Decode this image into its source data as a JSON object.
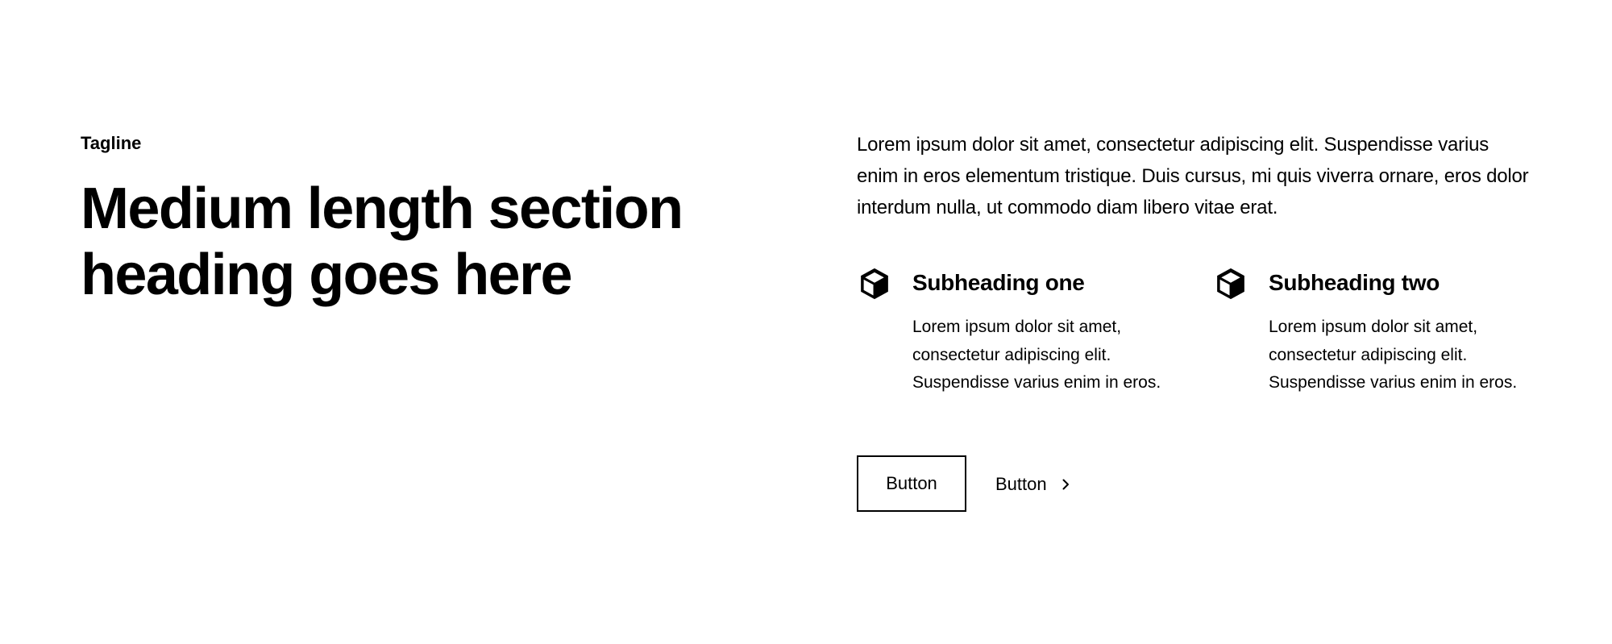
{
  "left": {
    "tagline": "Tagline",
    "heading_line1": "Medium length section",
    "heading_line2": "heading goes here"
  },
  "right": {
    "intro": "Lorem ipsum dolor sit amet, consectetur adipiscing elit. Suspendisse varius enim in eros elementum tristique. Duis cursus, mi quis viverra ornare, eros dolor interdum nulla, ut commodo diam libero vitae erat.",
    "features": [
      {
        "icon": "cube-icon",
        "title": "Subheading one",
        "description": "Lorem ipsum dolor sit amet, consectetur adipiscing elit. Suspendisse varius enim in eros."
      },
      {
        "icon": "cube-icon",
        "title": "Subheading two",
        "description": "Lorem ipsum dolor sit amet, consectetur adipiscing elit. Suspendisse varius enim in eros."
      }
    ],
    "actions": {
      "primary_label": "Button",
      "secondary_label": "Button",
      "secondary_icon": "chevron-right-icon"
    }
  },
  "colors": {
    "text": "#000000",
    "background": "#ffffff"
  }
}
